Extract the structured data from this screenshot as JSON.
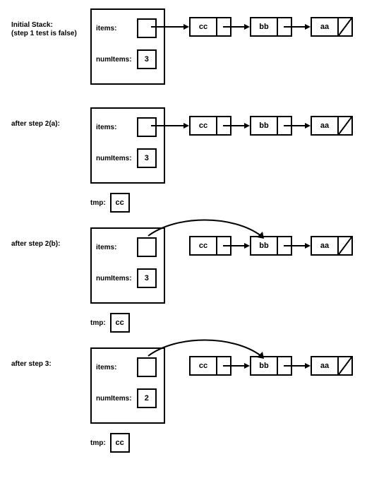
{
  "stages": [
    {
      "label_line1": "Initial Stack:",
      "label_line2": "(step 1 test is false)",
      "items_label": "items:",
      "numitems_label": "numItems:",
      "numitems_value": "3",
      "nodes": {
        "n1": "cc",
        "n2": "bb",
        "n3": "aa"
      },
      "has_tmp": false
    },
    {
      "label_line1": "after step 2(a):",
      "label_line2": "",
      "items_label": "items:",
      "numitems_label": "numItems:",
      "numitems_value": "3",
      "nodes": {
        "n1": "cc",
        "n2": "bb",
        "n3": "aa"
      },
      "has_tmp": true,
      "tmp_label": "tmp:",
      "tmp_value": "cc"
    },
    {
      "label_line1": "after step 2(b):",
      "label_line2": "",
      "items_label": "items:",
      "numitems_label": "numItems:",
      "numitems_value": "3",
      "nodes": {
        "n1": "cc",
        "n2": "bb",
        "n3": "aa"
      },
      "has_tmp": true,
      "tmp_label": "tmp:",
      "tmp_value": "cc",
      "skip_first_node": true
    },
    {
      "label_line1": "after step 3:",
      "label_line2": "",
      "items_label": "items:",
      "numitems_label": "numItems:",
      "numitems_value": "2",
      "nodes": {
        "n1": "cc",
        "n2": "bb",
        "n3": "aa"
      },
      "has_tmp": true,
      "tmp_label": "tmp:",
      "tmp_value": "cc",
      "skip_first_node": true
    }
  ],
  "chart_data": {
    "type": "diagram",
    "title": "Stack pop operation on a linked-list stack",
    "steps": [
      {
        "name": "Initial Stack",
        "note": "step 1 test is false",
        "numItems": 3,
        "items": [
          "cc",
          "bb",
          "aa"
        ],
        "items_head": "cc"
      },
      {
        "name": "after step 2(a)",
        "numItems": 3,
        "items": [
          "cc",
          "bb",
          "aa"
        ],
        "items_head": "cc",
        "tmp": "cc"
      },
      {
        "name": "after step 2(b)",
        "numItems": 3,
        "items": [
          "cc",
          "bb",
          "aa"
        ],
        "items_head": "bb",
        "tmp": "cc"
      },
      {
        "name": "after step 3",
        "numItems": 2,
        "items": [
          "cc",
          "bb",
          "aa"
        ],
        "items_head": "bb",
        "tmp": "cc"
      }
    ]
  }
}
